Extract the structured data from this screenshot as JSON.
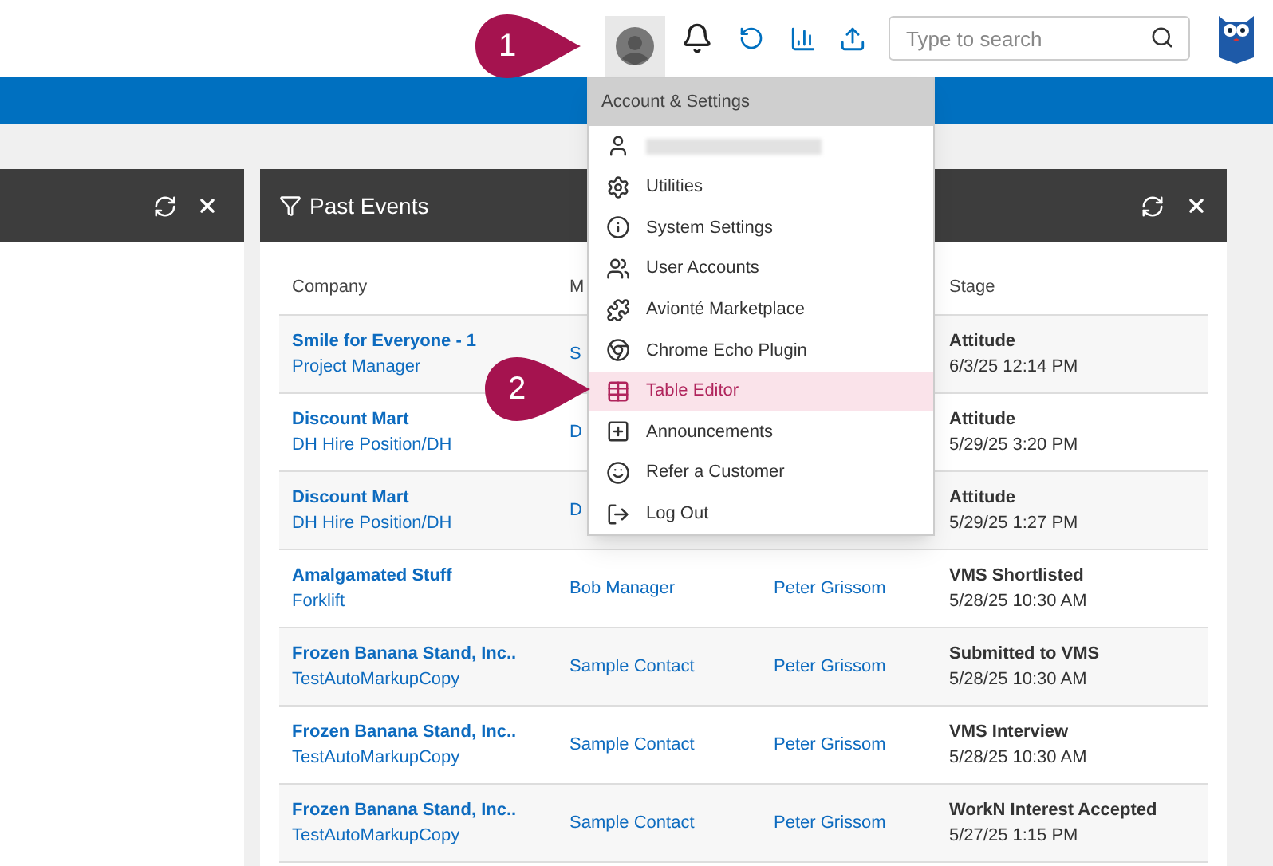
{
  "header": {
    "search": {
      "placeholder": "Type to search"
    }
  },
  "callouts": [
    "1",
    "2"
  ],
  "panel": {
    "title": "Past Events",
    "columns": [
      "Company",
      "M",
      "Stage"
    ],
    "rows": [
      {
        "company": "Smile for Everyone - 1",
        "position": "Project Manager",
        "column_2": "S",
        "stage": "Attitude",
        "date": "6/3/25 12:14 PM"
      },
      {
        "company": "Discount Mart",
        "position": "DH Hire Position/DH",
        "column_2": "D",
        "stage": "Attitude",
        "date": "5/29/25 3:20 PM"
      },
      {
        "company": "Discount Mart",
        "position": "DH Hire Position/DH",
        "column_2": "D",
        "stage": "Attitude",
        "date": "5/29/25 1:27 PM"
      },
      {
        "company": "Amalgamated Stuff",
        "position": "Forklift",
        "column_2": "Bob Manager",
        "column_3": "Peter Grissom",
        "stage": "VMS Shortlisted",
        "date": "5/28/25 10:30 AM"
      },
      {
        "company": "Frozen Banana Stand, Inc..",
        "position": "TestAutoMarkupCopy",
        "column_2": "Sample Contact",
        "column_3": "Peter Grissom",
        "stage": "Submitted to VMS",
        "date": "5/28/25 10:30 AM"
      },
      {
        "company": "Frozen Banana Stand, Inc..",
        "position": "TestAutoMarkupCopy",
        "column_2": "Sample Contact",
        "column_3": "Peter Grissom",
        "stage": "VMS Interview",
        "date": "5/28/25 10:30 AM"
      },
      {
        "company": "Frozen Banana Stand, Inc..",
        "position": "TestAutoMarkupCopy",
        "column_2": "Sample Contact",
        "column_3": "Peter Grissom",
        "stage": "WorkN Interest Accepted",
        "date": "5/27/25 1:15 PM"
      }
    ]
  },
  "menu": {
    "title": "Account & Settings",
    "items": [
      {
        "kind": "user",
        "selected": false
      },
      {
        "kind": "gear",
        "label": "Utilities",
        "selected": false
      },
      {
        "kind": "info",
        "label": "System Settings",
        "selected": false
      },
      {
        "kind": "users",
        "label": "User Accounts",
        "selected": false
      },
      {
        "kind": "puzzle",
        "label": "Avionté Marketplace",
        "selected": false
      },
      {
        "kind": "chrome",
        "label": "Chrome Echo Plugin",
        "selected": false
      },
      {
        "kind": "table",
        "label": "Table Editor",
        "selected": true
      },
      {
        "kind": "plus",
        "label": "Announcements",
        "selected": false
      },
      {
        "kind": "smile",
        "label": "Refer a Customer",
        "selected": false
      },
      {
        "kind": "logout",
        "label": "Log Out",
        "selected": false
      }
    ]
  }
}
